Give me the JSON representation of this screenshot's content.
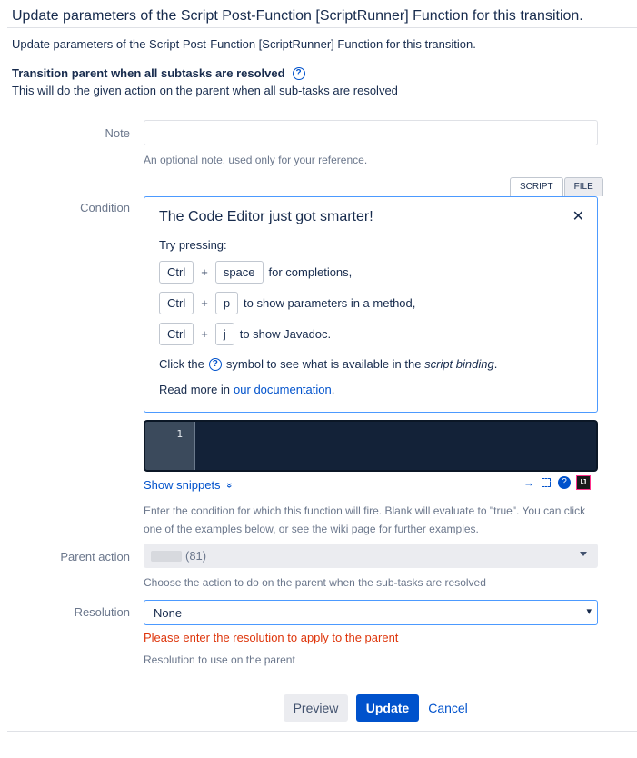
{
  "header": {
    "title": "Update parameters of the Script Post-Function [ScriptRunner] Function for this transition.",
    "intro": "Update parameters of the Script Post-Function [ScriptRunner] Function for this transition."
  },
  "function": {
    "title": "Transition parent when all subtasks are resolved",
    "help_icon": "?",
    "description": "This will do the given action on the parent when all sub-tasks are resolved"
  },
  "note": {
    "label": "Note",
    "value": "",
    "description": "An optional note, used only for your reference."
  },
  "condition": {
    "label": "Condition",
    "tabs": [
      "SCRIPT",
      "FILE"
    ],
    "tip": {
      "heading": "The Code Editor just got smarter!",
      "close_icon": "✕",
      "try_pressing": "Try pressing:",
      "shortcuts": [
        {
          "key1": "Ctrl",
          "plus": "+",
          "key2": "space",
          "text": "for completions,"
        },
        {
          "key1": "Ctrl",
          "plus": "+",
          "key2": "p",
          "text": "to show parameters in a method,"
        },
        {
          "key1": "Ctrl",
          "plus": "+",
          "key2": "j",
          "text": "to show Javadoc."
        }
      ],
      "click_prefix": "Click the",
      "help_glyph": "?",
      "click_middle": "symbol to see what is available in the",
      "click_italic": "script binding",
      "click_end": ".",
      "read_more": "Read more in",
      "doc_link": "our documentation",
      "read_end": "."
    },
    "editor": {
      "line_number": "1",
      "content": ""
    },
    "show_snippets": "Show snippets",
    "snippets_icon": "»",
    "tools": {
      "arrow_icon": "→",
      "fullscreen_icon": "⛶",
      "help_icon": "?",
      "ij_icon": "IJ"
    },
    "description": "Enter the condition for which this function will fire. Blank will evaluate to \"true\". You can click one of the examples below, or see the wiki page for further examples."
  },
  "parent_action": {
    "label": "Parent action",
    "value": "(81)",
    "description": "Choose the action to do on the parent when the sub-tasks are resolved"
  },
  "resolution": {
    "label": "Resolution",
    "value": "None",
    "caret": "▾",
    "error": "Please enter the resolution to apply to the parent",
    "description": "Resolution to use on the parent"
  },
  "actions": {
    "preview": "Preview",
    "update": "Update",
    "cancel": "Cancel"
  }
}
